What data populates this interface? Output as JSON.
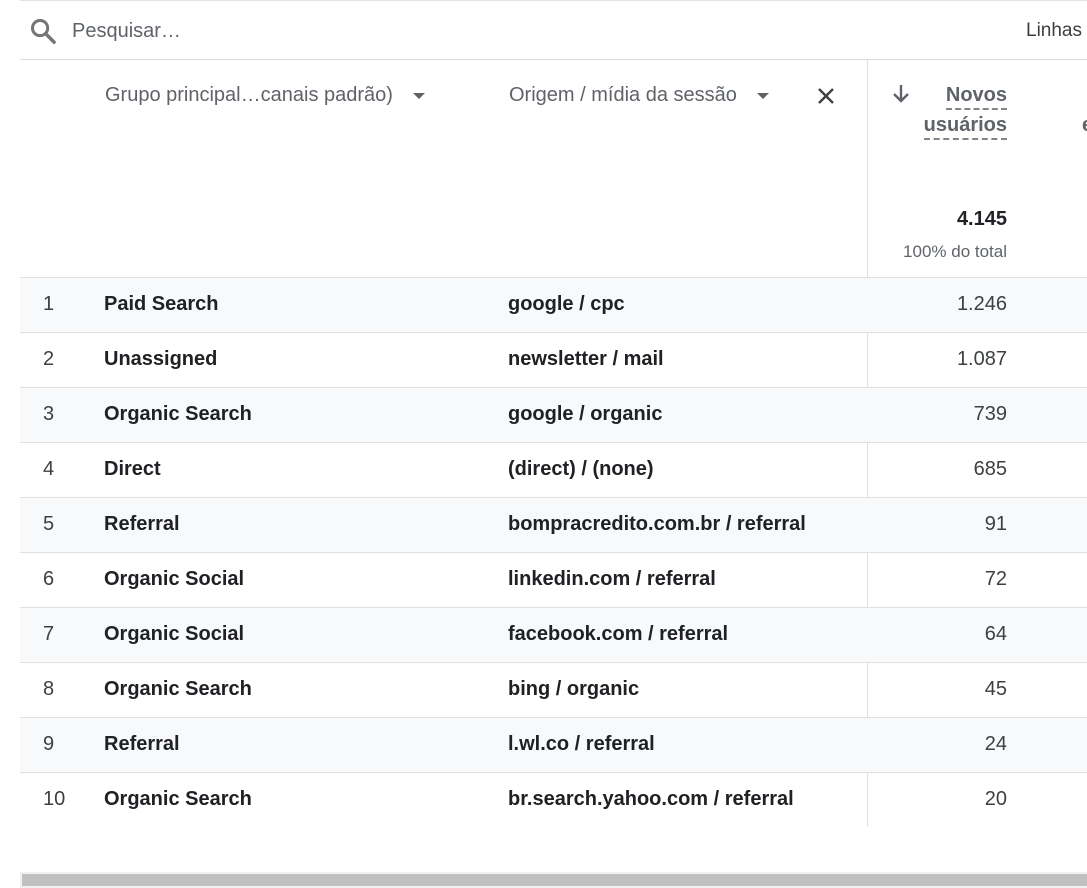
{
  "search": {
    "placeholder": "Pesquisar…",
    "rows_label": "Linhas"
  },
  "columns": {
    "dim1_label": "Grupo principal…canais padrão)",
    "dim2_label": "Origem / mídia da sessão",
    "metric_line1": "Novos",
    "metric_line2": "usuários",
    "next_col_fragment": "e"
  },
  "totals": {
    "value": "4.145",
    "pct": "100% do total"
  },
  "rows": [
    {
      "idx": "1",
      "channel": "Paid Search",
      "source": "google / cpc",
      "value": "1.246"
    },
    {
      "idx": "2",
      "channel": "Unassigned",
      "source": "newsletter / mail",
      "value": "1.087"
    },
    {
      "idx": "3",
      "channel": "Organic Search",
      "source": "google / organic",
      "value": "739"
    },
    {
      "idx": "4",
      "channel": "Direct",
      "source": "(direct) / (none)",
      "value": "685"
    },
    {
      "idx": "5",
      "channel": "Referral",
      "source": "bompracredito.com.br / referral",
      "value": "91"
    },
    {
      "idx": "6",
      "channel": "Organic Social",
      "source": "linkedin.com / referral",
      "value": "72"
    },
    {
      "idx": "7",
      "channel": "Organic Social",
      "source": "facebook.com / referral",
      "value": "64"
    },
    {
      "idx": "8",
      "channel": "Organic Search",
      "source": "bing / organic",
      "value": "45"
    },
    {
      "idx": "9",
      "channel": "Referral",
      "source": "l.wl.co / referral",
      "value": "24"
    },
    {
      "idx": "10",
      "channel": "Organic Search",
      "source": "br.search.yahoo.com / referral",
      "value": "20"
    }
  ],
  "icons": {
    "search": "search-icon",
    "sort": "arrow-down-icon",
    "caret": "caret-down-icon",
    "remove": "close-icon"
  },
  "colors": {
    "row_alt": "#f8f9fa",
    "text_secondary": "#5f6368",
    "divider": "#e0e0e0"
  }
}
